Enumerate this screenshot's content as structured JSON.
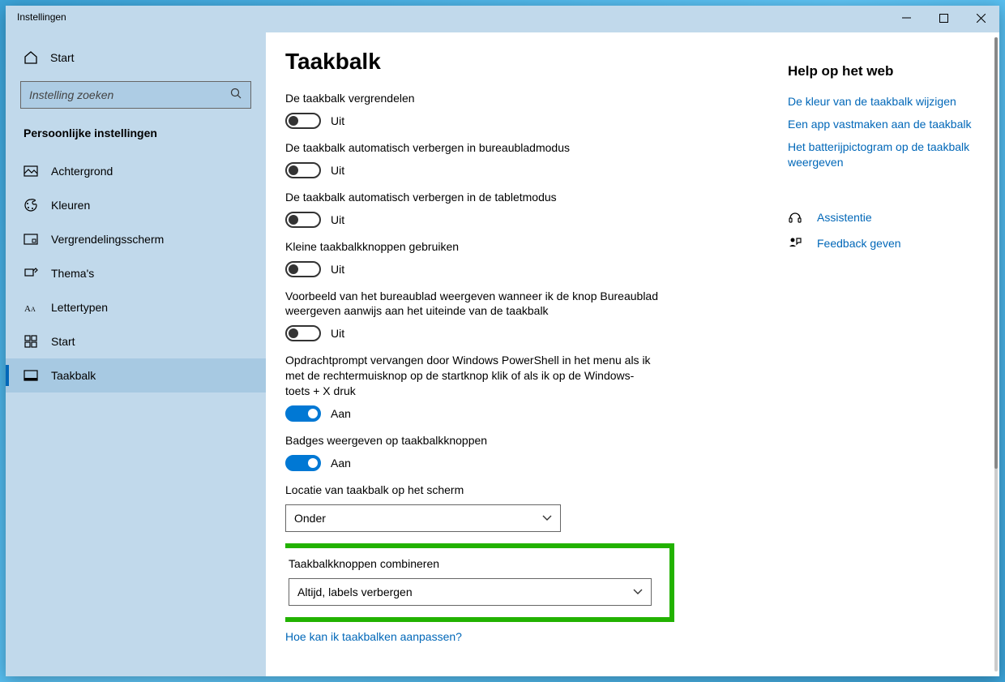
{
  "window": {
    "title": "Instellingen"
  },
  "sidebar": {
    "home_label": "Start",
    "search_placeholder": "Instelling zoeken",
    "category": "Persoonlijke instellingen",
    "items": [
      {
        "label": "Achtergrond"
      },
      {
        "label": "Kleuren"
      },
      {
        "label": "Vergrendelingsscherm"
      },
      {
        "label": "Thema's"
      },
      {
        "label": "Lettertypen"
      },
      {
        "label": "Start"
      },
      {
        "label": "Taakbalk"
      }
    ]
  },
  "page": {
    "title": "Taakbalk",
    "toggles": [
      {
        "label": "De taakbalk vergrendelen",
        "state_label": "Uit",
        "on": false
      },
      {
        "label": "De taakbalk automatisch verbergen in bureaubladmodus",
        "state_label": "Uit",
        "on": false
      },
      {
        "label": "De taakbalk automatisch verbergen in de tabletmodus",
        "state_label": "Uit",
        "on": false
      },
      {
        "label": "Kleine taakbalkknoppen gebruiken",
        "state_label": "Uit",
        "on": false
      },
      {
        "label": "Voorbeeld van het bureaublad weergeven wanneer ik de knop Bureaublad weergeven aanwijs aan het uiteinde van de taakbalk",
        "state_label": "Uit",
        "on": false
      },
      {
        "label": "Opdrachtprompt vervangen door Windows PowerShell in het menu als ik met de rechtermuisknop op de startknop klik of als ik op de Windows-toets + X druk",
        "state_label": "Aan",
        "on": true
      },
      {
        "label": "Badges weergeven op taakbalkknoppen",
        "state_label": "Aan",
        "on": true
      }
    ],
    "location": {
      "label": "Locatie van taakbalk op het scherm",
      "value": "Onder"
    },
    "combine": {
      "label": "Taakbalkknoppen combineren",
      "value": "Altijd, labels verbergen"
    },
    "help_link": "Hoe kan ik taakbalken aanpassen?"
  },
  "right": {
    "help_title": "Help op het web",
    "links": [
      "De kleur van de taakbalk wijzigen",
      "Een app vastmaken aan de taakbalk",
      "Het batterijpictogram op de taakbalk weergeven"
    ],
    "assist": "Assistentie",
    "feedback": "Feedback geven"
  }
}
